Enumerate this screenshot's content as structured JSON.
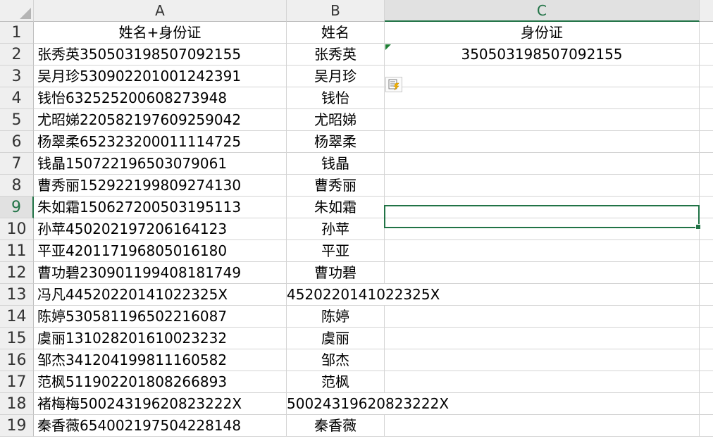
{
  "columns": {
    "a": "A",
    "b": "B",
    "c": "C"
  },
  "headers": {
    "a": "姓名+身份证",
    "b": "姓名",
    "c": "身份证"
  },
  "rows": [
    {
      "num": "1"
    },
    {
      "num": "2",
      "a": "张秀英350503198507092155",
      "b": "张秀英",
      "c": "350503198507092155"
    },
    {
      "num": "3",
      "a": "吴月珍530902201001242391",
      "b": "吴月珍",
      "c": ""
    },
    {
      "num": "4",
      "a": "钱怡632525200608273948",
      "b": "钱怡",
      "c": ""
    },
    {
      "num": "5",
      "a": "尤昭娣220582197609259042",
      "b": "尤昭娣",
      "c": ""
    },
    {
      "num": "6",
      "a": "杨翠柔652323200011114725",
      "b": "杨翠柔",
      "c": ""
    },
    {
      "num": "7",
      "a": "钱晶150722196503079061",
      "b": "钱晶",
      "c": ""
    },
    {
      "num": "8",
      "a": "曹秀丽152922199809274130",
      "b": "曹秀丽",
      "c": ""
    },
    {
      "num": "9",
      "a": "朱如霜150627200503195113",
      "b": "朱如霜",
      "c": ""
    },
    {
      "num": "10",
      "a": "孙苹450202197206164123",
      "b": "孙苹",
      "c": ""
    },
    {
      "num": "11",
      "a": "平亚420117196805016180",
      "b": "平亚",
      "c": ""
    },
    {
      "num": "12",
      "a": "曹功碧230901199408181749",
      "b": "曹功碧",
      "c": ""
    },
    {
      "num": "13",
      "a": "冯凡44520220141022325X",
      "b": "4520220141022325X",
      "c": ""
    },
    {
      "num": "14",
      "a": "陈婷530581196502216087",
      "b": "陈婷",
      "c": ""
    },
    {
      "num": "15",
      "a": "虞丽131028201610023232",
      "b": "虞丽",
      "c": ""
    },
    {
      "num": "16",
      "a": "邹杰341204199811160582",
      "b": "邹杰",
      "c": ""
    },
    {
      "num": "17",
      "a": "范枫511902201808266893",
      "b": "范枫",
      "c": ""
    },
    {
      "num": "18",
      "a": "褚梅梅50024319620823222X",
      "b": "50024319620823222X",
      "c": ""
    },
    {
      "num": "19",
      "a": "秦香薇654002197504228148",
      "b": "秦香薇",
      "c": ""
    }
  ],
  "selected_cell": "C9",
  "icons": {
    "quick_analysis": "flash-fill-options-icon",
    "corner": "select-all-icon"
  }
}
